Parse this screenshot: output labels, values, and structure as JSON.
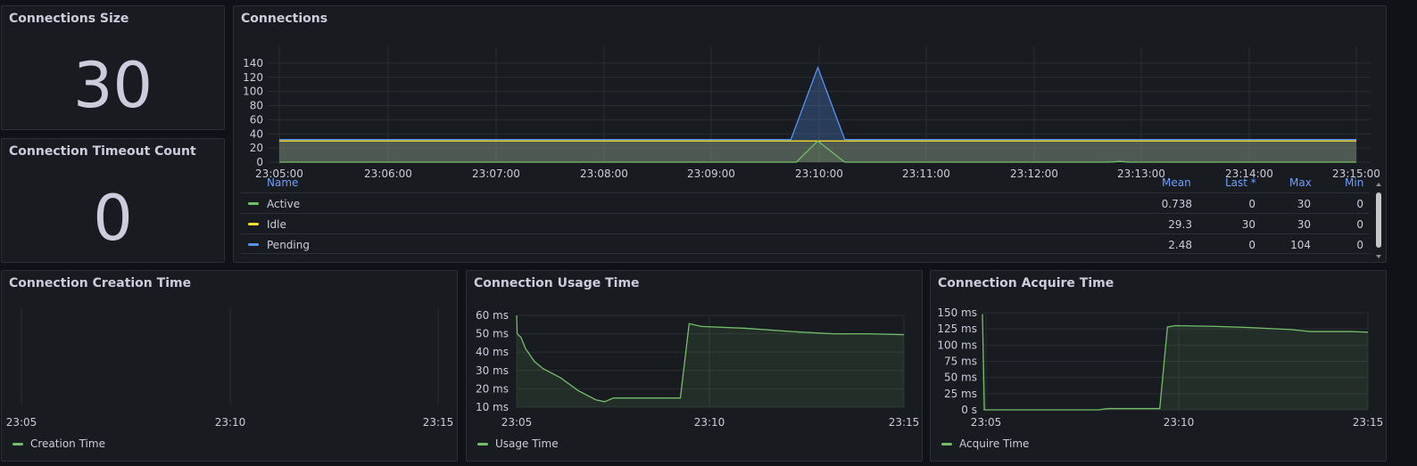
{
  "panels": {
    "conn_size": {
      "title": "Connections Size",
      "value": "30"
    },
    "timeout": {
      "title": "Connection Timeout Count",
      "value": "0"
    },
    "connections": {
      "title": "Connections",
      "legend_headers": {
        "name": "Name",
        "mean": "Mean",
        "last": "Last *",
        "max": "Max",
        "min": "Min"
      },
      "legend_rows": [
        {
          "name": "Active",
          "color": "#73bf69",
          "mean": "0.738",
          "last": "0",
          "max": "30",
          "min": "0"
        },
        {
          "name": "Idle",
          "color": "#fade2a",
          "mean": "29.3",
          "last": "30",
          "max": "30",
          "min": "0"
        },
        {
          "name": "Pending",
          "color": "#5794f2",
          "mean": "2.48",
          "last": "0",
          "max": "104",
          "min": "0"
        }
      ]
    },
    "creation": {
      "title": "Connection Creation Time",
      "legend": "Creation Time"
    },
    "usage": {
      "title": "Connection Usage Time",
      "legend": "Usage Time"
    },
    "acquire": {
      "title": "Connection Acquire Time",
      "legend": "Acquire Time"
    }
  },
  "chart_data": [
    {
      "type": "line",
      "name": "Connections",
      "x": [
        "23:05:00",
        "23:06:00",
        "23:07:00",
        "23:08:00",
        "23:09:00",
        "23:10:00",
        "23:11:00",
        "23:12:00",
        "23:13:00",
        "23:14:00",
        "23:15:00"
      ],
      "yticks": [
        "0",
        "20",
        "40",
        "60",
        "80",
        "100",
        "120",
        "140"
      ],
      "ylim": [
        0,
        150
      ],
      "series": [
        {
          "name": "Active",
          "color": "#73bf69",
          "points": [
            [
              0,
              0
            ],
            [
              4.8,
              0
            ],
            [
              5,
              30
            ],
            [
              5.25,
              0
            ],
            [
              7.7,
              0
            ],
            [
              7.8,
              1
            ],
            [
              7.9,
              0
            ],
            [
              10,
              0
            ]
          ]
        },
        {
          "name": "Idle",
          "color": "#fade2a",
          "points": [
            [
              0,
              30
            ],
            [
              4.75,
              30
            ],
            [
              5.25,
              30
            ],
            [
              10,
              30
            ]
          ]
        },
        {
          "name": "Pending",
          "color": "#5794f2",
          "points": [
            [
              0,
              32
            ],
            [
              4.75,
              32
            ],
            [
              5,
              134
            ],
            [
              5.25,
              32
            ],
            [
              10,
              32
            ]
          ]
        }
      ]
    },
    {
      "type": "line",
      "name": "Connection Creation Time",
      "x": [
        "23:05",
        "23:10",
        "23:15"
      ],
      "series": [
        {
          "name": "Creation Time",
          "values": []
        }
      ]
    },
    {
      "type": "area",
      "name": "Connection Usage Time",
      "x": [
        "23:05",
        "23:10",
        "23:15"
      ],
      "yticks": [
        "10 ms",
        "20 ms",
        "30 ms",
        "40 ms",
        "50 ms",
        "60 ms"
      ],
      "ylim": [
        10,
        60
      ],
      "series": [
        {
          "name": "Usage Time",
          "points": [
            [
              0,
              60
            ],
            [
              0.03,
              50
            ],
            [
              0.25,
              48
            ],
            [
              0.5,
              42
            ],
            [
              1,
              35
            ],
            [
              1.5,
              31
            ],
            [
              2.5,
              26
            ],
            [
              3.5,
              19
            ],
            [
              4.5,
              14
            ],
            [
              5,
              13
            ],
            [
              5.5,
              15
            ],
            [
              7,
              15
            ],
            [
              9.3,
              15
            ],
            [
              9.8,
              55.5
            ],
            [
              10.5,
              54
            ],
            [
              13,
              53
            ],
            [
              16,
              51
            ],
            [
              18,
              50
            ],
            [
              20,
              50
            ],
            [
              22,
              49.5
            ]
          ]
        }
      ]
    },
    {
      "type": "area",
      "name": "Connection Acquire Time",
      "x": [
        "23:05",
        "23:10",
        "23:15"
      ],
      "yticks": [
        "0 s",
        "25 ms",
        "50 ms",
        "75 ms",
        "100 ms",
        "125 ms",
        "150 ms"
      ],
      "ylim": [
        0,
        150
      ],
      "series": [
        {
          "name": "Acquire Time",
          "points": [
            [
              0,
              148
            ],
            [
              0.1,
              0
            ],
            [
              3,
              0
            ],
            [
              6,
              0
            ],
            [
              6.5,
              2
            ],
            [
              8,
              2
            ],
            [
              9.2,
              2
            ],
            [
              9.6,
              128
            ],
            [
              10,
              130
            ],
            [
              12,
              129
            ],
            [
              14,
              127
            ],
            [
              16,
              124
            ],
            [
              17,
              121
            ],
            [
              19,
              121
            ],
            [
              20,
              120
            ]
          ]
        }
      ]
    }
  ]
}
